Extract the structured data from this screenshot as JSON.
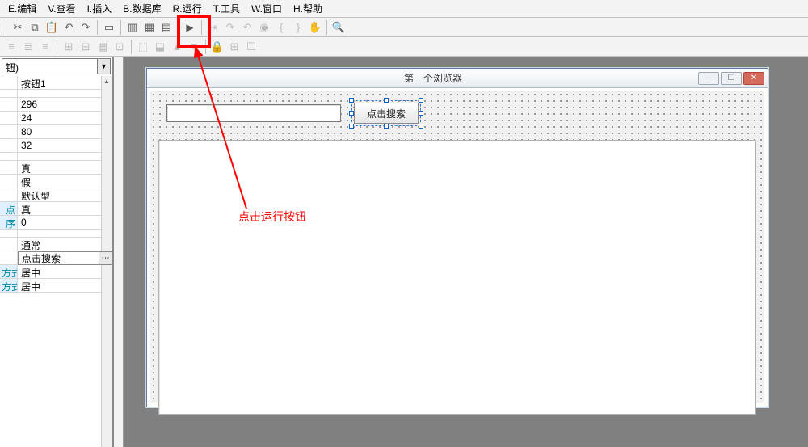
{
  "menu": {
    "edit": "E.编辑",
    "view": "V.查看",
    "insert": "I.插入",
    "database": "B.数据库",
    "run": "R.运行",
    "tools": "T.工具",
    "window": "W.窗口",
    "help": "H.帮助"
  },
  "properties": {
    "combo_value": "钮)",
    "name": "按钮1",
    "left": "296",
    "top": "24",
    "width": "80",
    "height": "32",
    "visible": "真",
    "disabled": "假",
    "style": "默认型",
    "tabstop": "真",
    "tabstop_label": "点",
    "taborder": "0",
    "taborder_label": "序",
    "type": "通常",
    "caption": "点击搜索",
    "halign": "居中",
    "halign_label": "方式",
    "valign": "居中",
    "valign_label": "方式"
  },
  "form": {
    "title": "第一个浏览器",
    "button_caption": "点击搜索"
  },
  "annotation": "点击运行按钮"
}
